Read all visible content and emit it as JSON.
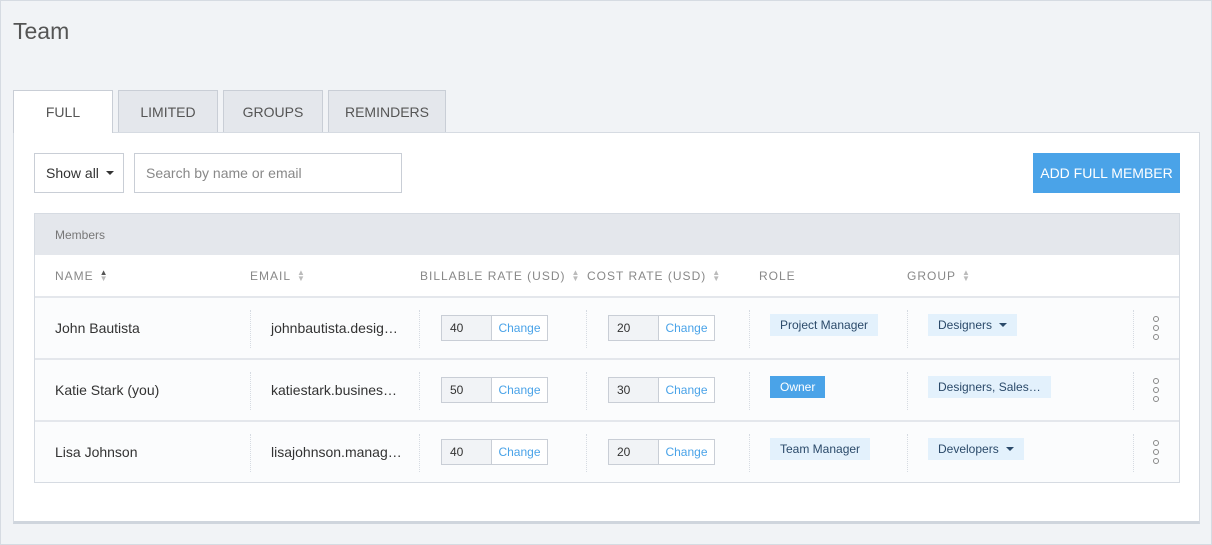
{
  "title": "Team",
  "tabs": [
    "FULL",
    "LIMITED",
    "GROUPS",
    "REMINDERS"
  ],
  "filter": {
    "selected": "Show all"
  },
  "search": {
    "placeholder": "Search by name or email",
    "value": ""
  },
  "add_button": "ADD FULL MEMBER",
  "table": {
    "section": "Members",
    "columns": [
      "NAME",
      "EMAIL",
      "BILLABLE RATE (USD)",
      "COST RATE (USD)",
      "ROLE",
      "GROUP"
    ],
    "change_label": "Change",
    "rows": [
      {
        "name": "John Bautista",
        "email": "johnbautista.desig…",
        "billable": "40",
        "cost": "20",
        "role": "Project Manager",
        "group": "Designers"
      },
      {
        "name": "Katie Stark (you)",
        "email": "katiestark.busines…",
        "billable": "50",
        "cost": "30",
        "role": "Owner",
        "group": "Designers, Sales…"
      },
      {
        "name": "Lisa Johnson",
        "email": "lisajohnson.manag…",
        "billable": "40",
        "cost": "20",
        "role": "Team Manager",
        "group": "Developers"
      }
    ]
  }
}
